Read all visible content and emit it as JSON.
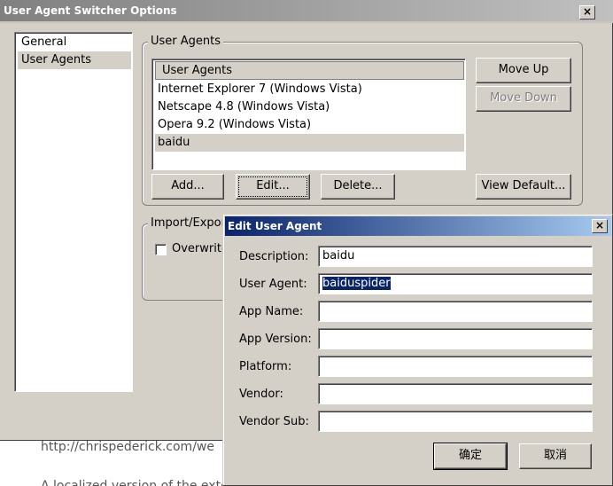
{
  "background": {
    "url_text": "http://chrispederick.com/we",
    "partial_line": "A localized version of the extension is also available"
  },
  "window": {
    "title": "User Agent Switcher Options",
    "close_glyph": "×",
    "categories": [
      {
        "label": "General",
        "selected": false
      },
      {
        "label": "User Agents",
        "selected": true
      }
    ],
    "ua_group_label": "User Agents",
    "ua_list_header": "User Agents",
    "ua_items": [
      {
        "label": "Internet Explorer 7 (Windows Vista)",
        "selected": false
      },
      {
        "label": "Netscape 4.8 (Windows Vista)",
        "selected": false
      },
      {
        "label": "Opera 9.2 (Windows Vista)",
        "selected": false
      },
      {
        "label": "baidu",
        "selected": true
      }
    ],
    "buttons": {
      "move_up": "Move Up",
      "move_down": "Move Down",
      "add": "Add...",
      "edit": "Edit...",
      "delete": "Delete...",
      "view_default": "View Default..."
    },
    "import_group_label": "Import/Export",
    "overwrite_label": "Overwrite"
  },
  "dialog": {
    "title": "Edit User Agent",
    "close_glyph": "×",
    "fields": {
      "description": {
        "label": "Description:",
        "value": "baidu"
      },
      "user_agent": {
        "label": "User Agent:",
        "value": "baiduspider"
      },
      "app_name": {
        "label": "App Name:",
        "value": ""
      },
      "app_version": {
        "label": "App Version:",
        "value": ""
      },
      "platform": {
        "label": "Platform:",
        "value": ""
      },
      "vendor": {
        "label": "Vendor:",
        "value": ""
      },
      "vendor_sub": {
        "label": "Vendor Sub:",
        "value": ""
      }
    },
    "ok_label": "确定",
    "cancel_label": "取消"
  },
  "colors": {
    "dialog_titlebar": "#0a246a",
    "inactive_titlebar": "#808080",
    "face": "#d4d0c8",
    "selection": "#0a246a"
  }
}
